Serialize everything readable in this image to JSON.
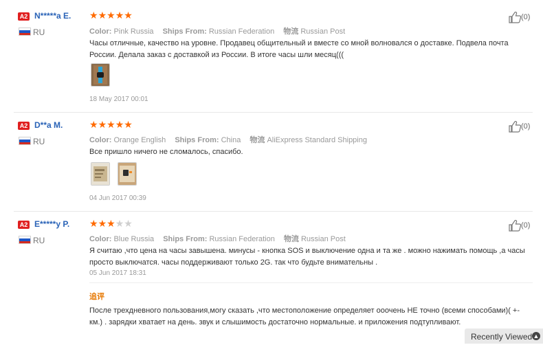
{
  "reviews": [
    {
      "level": "A2",
      "name": "N*****a E.",
      "country": "RU",
      "rating": 5,
      "color_label": "Color:",
      "color": "Pink Russia",
      "ships_label": "Ships From:",
      "ships_from": "Russian Federation",
      "logistics_label": "物流",
      "logistics": "Russian Post",
      "text": "Часы отличные, качество на уровне. Продавец общительный и вместе со мной волновался о доставке. Подвела почта России. Делала заказ с доставкой из России. В итоге часы шли месяц(((",
      "date": "18 May 2017 00:01",
      "helpful": "(0)",
      "photos": [
        "watch-photo"
      ]
    },
    {
      "level": "A2",
      "name": "D**a M.",
      "country": "RU",
      "rating": 5,
      "color_label": "Color:",
      "color": "Orange English",
      "ships_label": "Ships From:",
      "ships_from": "China",
      "logistics_label": "物流",
      "logistics": "AliExpress Standard Shipping",
      "text": "Все пришло ничего не сломалось, спасибо.",
      "date": "04 Jun 2017 00:39",
      "helpful": "(0)",
      "photos": [
        "package-photo",
        "watch-photo"
      ]
    },
    {
      "level": "A2",
      "name": "E*****y P.",
      "country": "RU",
      "rating": 3,
      "color_label": "Color:",
      "color": "Blue Russia",
      "ships_label": "Ships From:",
      "ships_from": "Russian Federation",
      "logistics_label": "物流",
      "logistics": "Russian Post",
      "text": "Я считаю ,что цена на часы завышена. минусы - кнопка SOS и выключение одна и та же . можно нажимать помощь ,а часы просто выключатся. часы поддерживают только 2G. так что будьте внимательны .",
      "date": "05 Jun 2017 18:31",
      "helpful": "(0)",
      "additional_label": "追评",
      "additional_text": "После трехдневного пользования,могу сказать ,что местоположение определяет ооочень НЕ точно (всеми способами)( +- км.) . зарядки хватает на день. звук и слышимость достаточно нормальные. и приложения подтупливают."
    }
  ],
  "recently_viewed": "Recently Viewed",
  "colors": {
    "accent": "#ff6a00",
    "name": "#2a63b7",
    "badge": "#e02020"
  }
}
